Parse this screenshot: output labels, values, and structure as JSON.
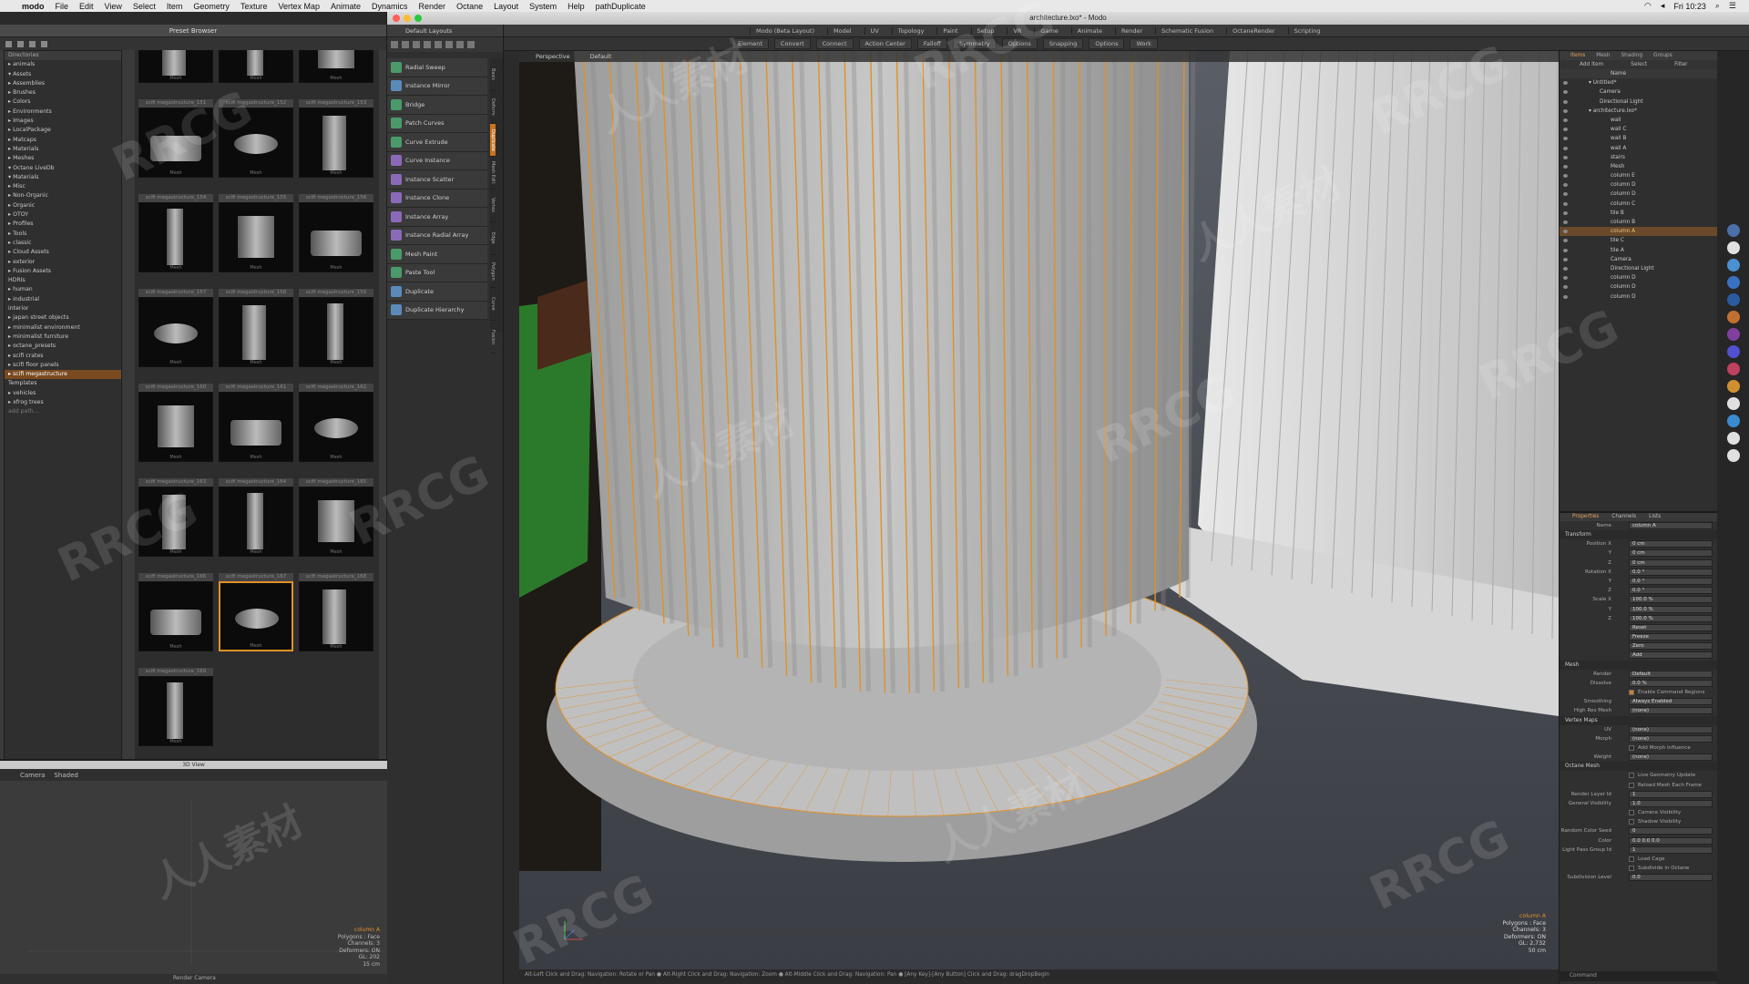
{
  "menubar": {
    "app": "modo",
    "items": [
      "File",
      "Edit",
      "View",
      "Select",
      "Item",
      "Geometry",
      "Texture",
      "Vertex Map",
      "Animate",
      "Dynamics",
      "Render",
      "Octane",
      "Layout",
      "System",
      "Help",
      "pathDuplicate"
    ],
    "clock": "Fri 10:23"
  },
  "window": {
    "title": "architecture.lxo* - Modo"
  },
  "preset_browser": {
    "title": "Preset Browser",
    "tree_header": "Directories",
    "tree": [
      {
        "label": "▸ animals"
      },
      {
        "label": "▾ Assets"
      },
      {
        "label": "   ▸ Assemblies"
      },
      {
        "label": "   ▸ Brushes"
      },
      {
        "label": "   ▸ Colors"
      },
      {
        "label": "   ▸ Environments"
      },
      {
        "label": "   ▸ Images"
      },
      {
        "label": "   ▸ LocalPackage"
      },
      {
        "label": "   ▸ Matcaps"
      },
      {
        "label": "   ▸ Materials"
      },
      {
        "label": "   ▸ Meshes"
      },
      {
        "label": "   ▾ Octane LiveDb"
      },
      {
        "label": "      ▾ Materials"
      },
      {
        "label": "         ▸ Misc"
      },
      {
        "label": "         ▸ Non-Organic"
      },
      {
        "label": "         ▸ Organic"
      },
      {
        "label": "   ▸ OTOY"
      },
      {
        "label": "   ▸ Profiles"
      },
      {
        "label": "   ▸ Tools"
      },
      {
        "label": "▸ classic"
      },
      {
        "label": "▸ Cloud Assets"
      },
      {
        "label": "▸ exterior"
      },
      {
        "label": "▸ Fusion Assets"
      },
      {
        "label": "  HDRIs"
      },
      {
        "label": "▸ human"
      },
      {
        "label": "▸ industrial"
      },
      {
        "label": "  interior"
      },
      {
        "label": "▸ japan street objects"
      },
      {
        "label": "▸ minimalist environment"
      },
      {
        "label": "▸ minimalist furniture"
      },
      {
        "label": "▸ octane_presets"
      },
      {
        "label": "▸ scifi crates"
      },
      {
        "label": "▸ scifi floor panels"
      },
      {
        "label": "▸ scifi megastructure",
        "selected": true
      },
      {
        "label": "  Templates"
      },
      {
        "label": "▸ vehicles"
      },
      {
        "label": "▸ xfrog trees"
      },
      {
        "label": "  add path...",
        "dim": true
      }
    ],
    "tiles": [
      {
        "name": "",
        "sub": "Mesh"
      },
      {
        "name": "",
        "sub": "Mesh"
      },
      {
        "name": "",
        "sub": "Mesh"
      },
      {
        "name": "scifi megastructure_151",
        "sub": "Mesh"
      },
      {
        "name": "scifi megastructure_152",
        "sub": "Mesh"
      },
      {
        "name": "scifi megastructure_153",
        "sub": "Mesh"
      },
      {
        "name": "scifi megastructure_154",
        "sub": "Mesh"
      },
      {
        "name": "scifi megastructure_155",
        "sub": "Mesh"
      },
      {
        "name": "scifi megastructure_156",
        "sub": "Mesh"
      },
      {
        "name": "scifi megastructure_157",
        "sub": "Mesh"
      },
      {
        "name": "scifi megastructure_158",
        "sub": "Mesh"
      },
      {
        "name": "scifi megastructure_159",
        "sub": "Mesh"
      },
      {
        "name": "scifi megastructure_160",
        "sub": "Mesh"
      },
      {
        "name": "scifi megastructure_161",
        "sub": "Mesh"
      },
      {
        "name": "scifi megastructure_162",
        "sub": "Mesh"
      },
      {
        "name": "scifi megastructure_163",
        "sub": "Mesh"
      },
      {
        "name": "scifi megastructure_164",
        "sub": "Mesh"
      },
      {
        "name": "scifi megastructure_165",
        "sub": "Mesh"
      },
      {
        "name": "scifi megastructure_166",
        "sub": "Mesh"
      },
      {
        "name": "scifi megastructure_167",
        "sub": "Mesh",
        "selected": true
      },
      {
        "name": "scifi megastructure_168",
        "sub": "Mesh"
      },
      {
        "name": "scifi megastructure_169",
        "sub": "Mesh"
      }
    ]
  },
  "mini_view": {
    "title": "3D View",
    "tabs": [
      "Camera",
      "Shaded"
    ],
    "footer": "Render Camera",
    "info": [
      "column A",
      "Polygons : Face",
      "Channels: 3",
      "Deformers: ON",
      "GL: 202",
      "15 cm"
    ]
  },
  "tool_palette": {
    "layout": "Default Layouts",
    "tools": [
      {
        "label": "Radial Sweep",
        "color": "#4a9a6a"
      },
      {
        "label": "Instance Mirror",
        "color": "#5a8ab8"
      },
      {
        "label": "Bridge",
        "color": "#4a9a6a"
      },
      {
        "label": "Patch Curves",
        "color": "#4a9a6a"
      },
      {
        "label": "Curve Extrude",
        "color": "#4a9a6a"
      },
      {
        "label": "Curve Instance",
        "color": "#8a6ab8"
      },
      {
        "label": "Instance Scatter",
        "color": "#8a6ab8"
      },
      {
        "label": "Instance Clone",
        "color": "#8a6ab8"
      },
      {
        "label": "Instance Array",
        "color": "#8a6ab8"
      },
      {
        "label": "Instance Radial Array",
        "color": "#8a6ab8"
      },
      {
        "label": "Mesh Paint",
        "color": "#4a9a6a"
      },
      {
        "label": "Paste Tool",
        "color": "#4a9a6a"
      },
      {
        "label": "Duplicate",
        "color": "#5a8ab8"
      },
      {
        "label": "Duplicate Hierarchy",
        "color": "#5a8ab8"
      }
    ],
    "vtabs": [
      "Basic",
      "Deform",
      "Duplicate",
      "Mesh Edit",
      "Vertex",
      "Edge",
      "Polygon",
      "Curve",
      "Fusion"
    ]
  },
  "toolbar": {
    "tabs": [
      "Modo (Beta Layout)",
      "Model",
      "UV",
      "Topology",
      "Paint",
      "Setup",
      "VR",
      "Game",
      "Animate",
      "Render",
      "Schematic Fusion",
      "OctaneRender",
      "Scripting"
    ],
    "actions": [
      "Element",
      "Convert",
      "Connect",
      "Action Center",
      "Falloff",
      "Symmetry",
      "Options",
      "Snapping",
      "Options",
      "Work"
    ]
  },
  "viewport": {
    "tabs": [
      "Perspective",
      "Default"
    ],
    "info": [
      {
        "text": "column A",
        "accent": true
      },
      {
        "text": "Polygons : Face"
      },
      {
        "text": "Channels: 3"
      },
      {
        "text": "Deformers: ON"
      },
      {
        "text": "GL: 2,732"
      },
      {
        "text": "50 cm"
      }
    ],
    "status": "Alt-Left Click and Drag: Navigation: Rotate or Pan ● Alt-Right Click and Drag: Navigation: Zoom ● Alt-Middle Click and Drag: Navigation: Pan ● [Any Key]-[Any Button] Click and Drag: dragDropBegin"
  },
  "items_list": {
    "tabs": [
      "Items",
      "Mesh",
      "Shading",
      "Groups"
    ],
    "tools": [
      "Add Item",
      "Select",
      "Filter"
    ],
    "header": "Name",
    "rows": [
      {
        "label": "▾ Untitled*",
        "indent": 1
      },
      {
        "label": "Camera",
        "indent": 2
      },
      {
        "label": "Directional Light",
        "indent": 2
      },
      {
        "label": "▾ architecture.lxo*",
        "indent": 1
      },
      {
        "label": "wall",
        "indent": 3
      },
      {
        "label": "wall C",
        "indent": 3
      },
      {
        "label": "wall B",
        "indent": 3
      },
      {
        "label": "wall A",
        "indent": 3
      },
      {
        "label": "stairs",
        "indent": 3
      },
      {
        "label": "Mesh",
        "indent": 3
      },
      {
        "label": "column E",
        "indent": 3
      },
      {
        "label": "column D",
        "indent": 3
      },
      {
        "label": "column D",
        "indent": 3
      },
      {
        "label": "column C",
        "indent": 3
      },
      {
        "label": "tile B",
        "indent": 3
      },
      {
        "label": "column B",
        "indent": 3
      },
      {
        "label": "column A",
        "indent": 3,
        "selected": true
      },
      {
        "label": "tile C",
        "indent": 3
      },
      {
        "label": "tile A",
        "indent": 3
      },
      {
        "label": "Camera",
        "indent": 3
      },
      {
        "label": "Directional Light",
        "indent": 3
      },
      {
        "label": "column D",
        "indent": 3
      },
      {
        "label": "column D",
        "indent": 3
      },
      {
        "label": "column D",
        "indent": 3
      }
    ]
  },
  "properties": {
    "tabs": [
      "Properties",
      "Channels",
      "Lists"
    ],
    "name_label": "Name",
    "name_value": "column A",
    "transform_title": "Transform",
    "transform": [
      {
        "k": "Position X",
        "v": "0 cm"
      },
      {
        "k": "Y",
        "v": "0 cm"
      },
      {
        "k": "Z",
        "v": "0 cm"
      },
      {
        "k": "Rotation X",
        "v": "0.0 °"
      },
      {
        "k": "Y",
        "v": "0.0 °"
      },
      {
        "k": "Z",
        "v": "0.0 °"
      },
      {
        "k": "Scale X",
        "v": "100.0 %"
      },
      {
        "k": "Y",
        "v": "100.0 %"
      },
      {
        "k": "Z",
        "v": "100.0 %"
      },
      {
        "k": "",
        "v": "Reset"
      },
      {
        "k": "",
        "v": "Freeze"
      },
      {
        "k": "",
        "v": "Zero"
      },
      {
        "k": "",
        "v": "Add"
      }
    ],
    "mesh_title": "Mesh",
    "mesh": [
      {
        "k": "Render",
        "v": "Default"
      },
      {
        "k": "Dissolve",
        "v": "0.0 %"
      },
      {
        "k": "",
        "chk": true,
        "on": true,
        "v": "Enable Command Regions"
      },
      {
        "k": "Smoothing",
        "v": "Always Enabled"
      },
      {
        "k": "High Res Mesh",
        "v": "(none)"
      }
    ],
    "vmaps_title": "Vertex Maps",
    "vmaps": [
      {
        "k": "UV",
        "v": "(none)"
      },
      {
        "k": "Morph",
        "v": "(none)"
      },
      {
        "k": "",
        "chk": true,
        "on": false,
        "v": "Add Morph Influence"
      },
      {
        "k": "Weight",
        "v": "(none)"
      }
    ],
    "octane_title": "Octane Mesh",
    "octane": [
      {
        "k": "",
        "chk": true,
        "on": false,
        "v": "Live Geometry Update"
      },
      {
        "k": "",
        "chk": true,
        "on": false,
        "v": "Reload Mesh Each Frame"
      },
      {
        "k": "Render Layer Id",
        "v": "1"
      },
      {
        "k": "General Visibility",
        "v": "1.0"
      },
      {
        "k": "",
        "chk": true,
        "on": false,
        "v": "Camera Visibility"
      },
      {
        "k": "",
        "chk": true,
        "on": false,
        "v": "Shadow Visibility"
      },
      {
        "k": "Random Color Seed",
        "v": "0"
      },
      {
        "k": "Color",
        "v": "0.0   0.0   0.0"
      },
      {
        "k": "Light Pass Group Id",
        "v": "1"
      },
      {
        "k": "",
        "chk": true,
        "on": false,
        "v": "Load Cage"
      },
      {
        "k": "",
        "chk": true,
        "on": false,
        "v": "Subdivide in Octane"
      },
      {
        "k": "Subdivision Level",
        "v": "0.0"
      }
    ],
    "command": "Command"
  },
  "watermarks": [
    "RRCG",
    "人人素材"
  ]
}
